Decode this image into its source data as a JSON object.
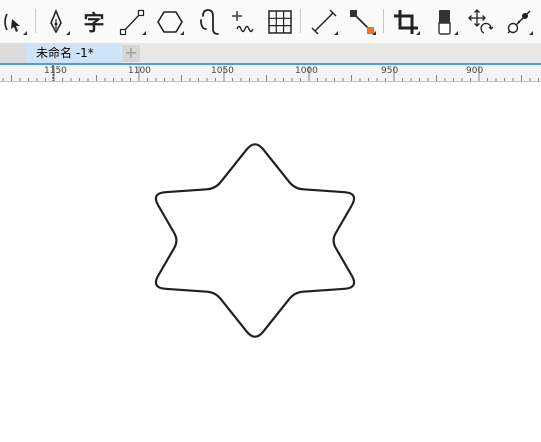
{
  "toolbar": {
    "tools": [
      {
        "name": "shape-tool",
        "icon": "shape-edit-icon"
      },
      {
        "name": "pen-tool",
        "icon": "pen-nib-icon"
      },
      {
        "name": "text-tool",
        "icon": "text-icon",
        "glyph": "字"
      },
      {
        "name": "line-tool",
        "icon": "2-point-line-icon"
      },
      {
        "name": "polygon-tool",
        "icon": "hexagon-icon"
      },
      {
        "name": "spiral-tool",
        "icon": "spiral-icon"
      },
      {
        "name": "artistic-media-tool",
        "icon": "artistic-media-icon"
      },
      {
        "name": "table-tool",
        "icon": "table-icon"
      },
      {
        "name": "dimension-tool",
        "icon": "parallel-dimension-icon"
      },
      {
        "name": "connector-tool",
        "icon": "connector-icon"
      },
      {
        "name": "crop-tool",
        "icon": "crop-icon"
      },
      {
        "name": "eraser-tool",
        "icon": "eraser-icon"
      },
      {
        "name": "transform-tool",
        "icon": "free-transform-icon"
      },
      {
        "name": "blend-tool",
        "icon": "blend-icon"
      }
    ]
  },
  "tabs": {
    "document_title": "未命名 -1*",
    "add_label": "+"
  },
  "ruler": {
    "labels": [
      "1150",
      "1100",
      "1050",
      "1000",
      "950",
      "900"
    ]
  },
  "canvas": {
    "shape": "rounded-six-point-star",
    "stroke_color": "#231f20",
    "fill_color": "#ffffff"
  },
  "colors": {
    "toolbar_bg": "#fafafa",
    "active_tab": "#cfe3f7",
    "tab_accent": "#4a9fe0",
    "connector_accent": "#e8742a"
  }
}
